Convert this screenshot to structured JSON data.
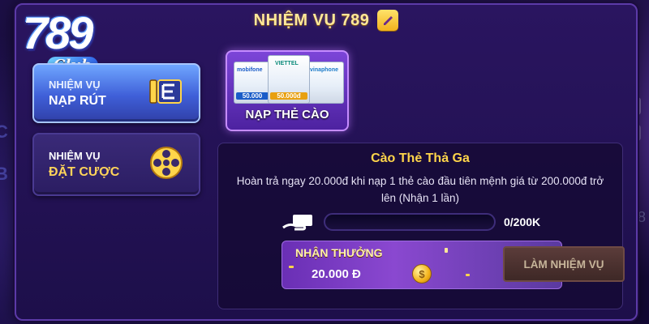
{
  "header": {
    "title": "NHIỆM VỤ 789"
  },
  "logo": {
    "number": "789",
    "club": "Club"
  },
  "tabs": [
    {
      "line1": "NHIỆM VỤ",
      "line2": "NẠP RÚT",
      "active": true,
      "icon": "deposit-withdraw-icon"
    },
    {
      "line1": "NHIỆM VỤ",
      "line2": "ĐẶT CƯỢC",
      "active": false,
      "icon": "film-reel-icon"
    }
  ],
  "card_tab": {
    "label": "NẠP THẺ CÀO",
    "cards": [
      {
        "brand": "mobifone",
        "amount": "50.000"
      },
      {
        "brand": "VIETTEL",
        "amount": "50.000đ"
      },
      {
        "brand": "vinaphone",
        "amount": ""
      }
    ]
  },
  "mission": {
    "title": "Cào Thẻ Thả Ga",
    "description": "Hoàn trả ngay 20.000đ khi nạp 1 thẻ cào đầu tiên mệnh giá từ 200.000đ trở lên (Nhận 1 lần)",
    "progress_text": "0/200K",
    "progress_fraction": 0,
    "reward_label": "NHẬN THƯỞNG",
    "reward_amount": "20.000 Đ",
    "coin_symbol": "$",
    "action_label": "LÀM NHIỆM VỤ"
  },
  "colors": {
    "title_gold": "#ffe89a",
    "accent_gold": "#ffd54a",
    "active_tab": "#4f74e0",
    "card_tab": "#7c45d8"
  }
}
